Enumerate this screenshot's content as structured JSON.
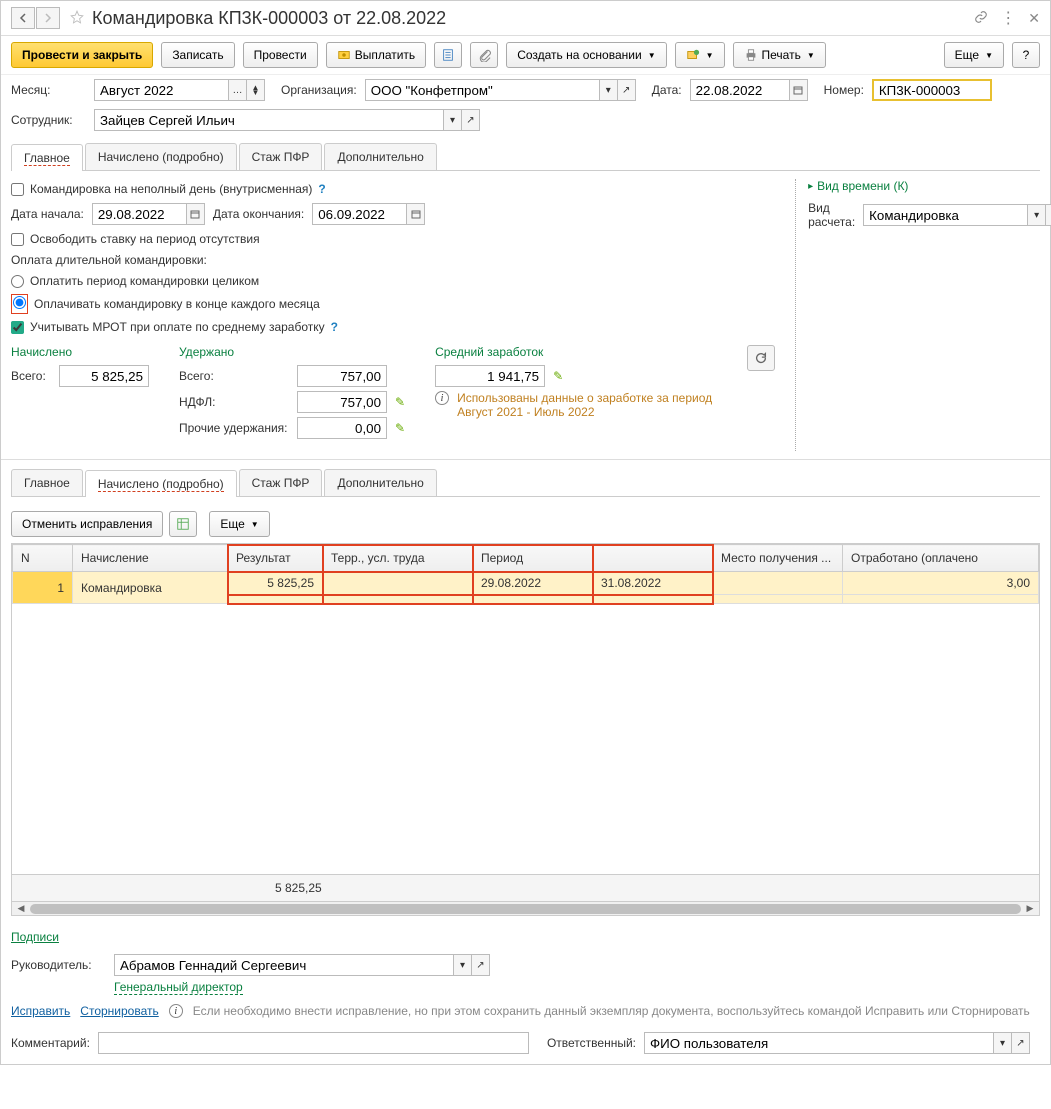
{
  "title": "Командировка КП3К-000003 от 22.08.2022",
  "toolbar": {
    "post_close": "Провести и закрыть",
    "save": "Записать",
    "post": "Провести",
    "pay": "Выплатить",
    "create_based": "Создать на основании",
    "print": "Печать",
    "more": "Еще"
  },
  "header": {
    "month_label": "Месяц:",
    "month_value": "Август 2022",
    "org_label": "Организация:",
    "org_value": "ООО \"Конфетпром\"",
    "date_label": "Дата:",
    "date_value": "22.08.2022",
    "number_label": "Номер:",
    "number_value": "КП3К-000003",
    "employee_label": "Сотрудник:",
    "employee_value": "Зайцев Сергей Ильич"
  },
  "tabs": {
    "main": "Главное",
    "accrued_detail": "Начислено (подробно)",
    "pfr": "Стаж ПФР",
    "extra": "Дополнительно"
  },
  "main_panel": {
    "partial_day": "Командировка на неполный день (внутрисменная)",
    "start_label": "Дата начала:",
    "start_value": "29.08.2022",
    "end_label": "Дата окончания:",
    "end_value": "06.09.2022",
    "free_rate": "Освободить ставку на период отсутствия",
    "long_trip_label": "Оплата длительной командировки:",
    "radio_whole": "Оплатить период командировки целиком",
    "radio_monthly": "Оплачивать командировку в конце каждого месяца",
    "mrot": "Учитывать МРОТ при оплате по среднему заработку",
    "time_kind": "Вид времени (К)",
    "calc_type_label": "Вид расчета:",
    "calc_type_value": "Командировка"
  },
  "totals": {
    "accrued_hdr": "Начислено",
    "withheld_hdr": "Удержано",
    "avg_hdr": "Средний заработок",
    "total_lbl": "Всего:",
    "accrued_total": "5 825,25",
    "withheld_total": "757,00",
    "ndfl_lbl": "НДФЛ:",
    "ndfl_val": "757,00",
    "other_lbl": "Прочие удержания:",
    "other_val": "0,00",
    "avg_val": "1 941,75",
    "info_text": "Использованы данные о заработке за период Август 2021 - Июль 2022"
  },
  "detail_panel": {
    "cancel_fix": "Отменить исправления",
    "more": "Еще",
    "cols": {
      "n": "N",
      "accrual": "Начисление",
      "result": "Результат",
      "terr": "Терр., усл. труда",
      "period": "Период",
      "period2": "",
      "place": "Место получения ...",
      "worked": "Отработано (оплаченo"
    },
    "row": {
      "n": "1",
      "accrual": "Командировка",
      "result": "5 825,25",
      "terr": "",
      "period_from": "29.08.2022",
      "period_to": "31.08.2022",
      "place": "",
      "worked": "3,00"
    },
    "footer_result": "5 825,25"
  },
  "signatures": {
    "header": "Подписи",
    "head_label": "Руководитель:",
    "head_value": "Абрамов Геннадий Сергеевич",
    "position": "Генеральный директор"
  },
  "footer": {
    "fix": "Исправить",
    "storno": "Сторнировать",
    "note": "Если необходимо внести исправление, но при этом сохранить данный экземпляр документа, воспользуйтесь командой Исправить или Сторнировать",
    "comment_label": "Комментарий:",
    "resp_label": "Ответственный:",
    "resp_value": "ФИО пользователя"
  }
}
